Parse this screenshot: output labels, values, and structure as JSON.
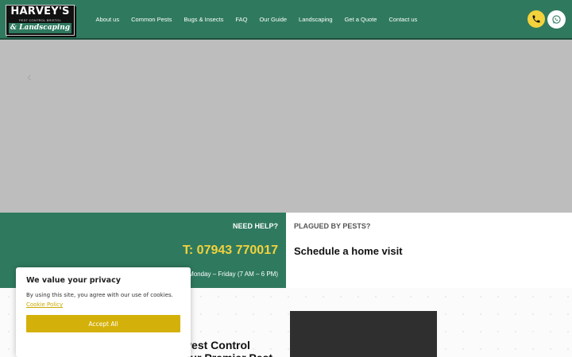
{
  "logo": {
    "main": "HARVEY'S",
    "sub": "PEST CONTROL BRISTOL",
    "script": "& Landscaping"
  },
  "nav": {
    "items": [
      {
        "label": "About us"
      },
      {
        "label": "Common Pests"
      },
      {
        "label": "Bugs & Insects"
      },
      {
        "label": "FAQ"
      },
      {
        "label": "Our Guide"
      },
      {
        "label": "Landscaping"
      },
      {
        "label": "Get a Quote"
      },
      {
        "label": "Contact us"
      }
    ]
  },
  "header_buttons": {
    "call_icon": "phone-icon",
    "whatsapp_icon": "whatsapp-icon"
  },
  "hero": {
    "arrow": "‹"
  },
  "help": {
    "heading": "NEED HELP?",
    "phone": "T: 07943 770017",
    "hours": "Monday – Friday (7 AM – 6 PM)"
  },
  "plagued": {
    "heading": "PLAGUED BY PESTS?",
    "cta": "Schedule a home visit"
  },
  "intro": {
    "title": "Harvey's Pest Control Bristol: Your Premier Pest"
  },
  "cookie": {
    "title": "We value your privacy",
    "text": "By using this site, you agree with our use of cookies.",
    "link": "Cookie Policy",
    "accept": "Accept All"
  },
  "colors": {
    "brand_green": "#2f7a5f",
    "accent_yellow": "#f3d23c",
    "cookie_button": "#d4b10a",
    "hero_grey": "#bdbdbd"
  }
}
